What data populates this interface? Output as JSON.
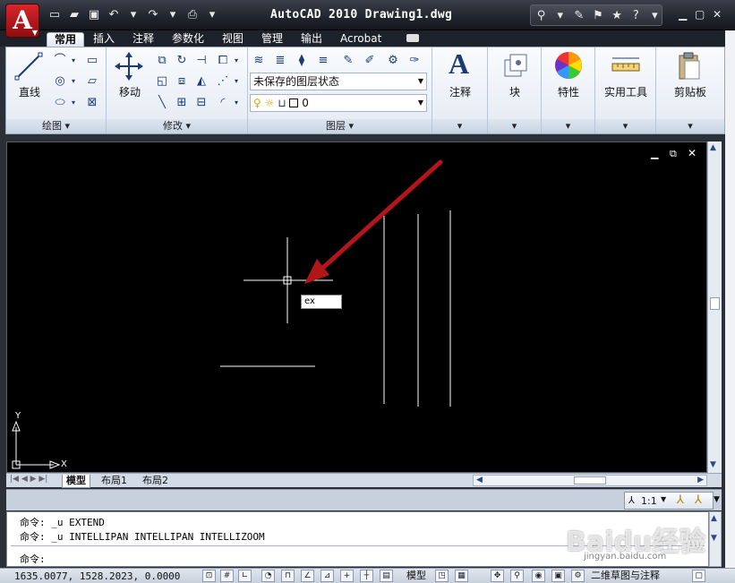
{
  "window": {
    "title": "AutoCAD 2010   Drawing1.dwg",
    "app_logo": "A",
    "brand_color": "#c8151b"
  },
  "ribbon_tabs": [
    {
      "label": "常用",
      "active": true
    },
    {
      "label": "插入"
    },
    {
      "label": "注释"
    },
    {
      "label": "参数化"
    },
    {
      "label": "视图"
    },
    {
      "label": "管理"
    },
    {
      "label": "输出"
    },
    {
      "label": "Acrobat"
    }
  ],
  "panels": {
    "draw": {
      "title": "绘图",
      "line_label": "直线"
    },
    "modify": {
      "title": "修改",
      "move_label": "移动"
    },
    "layers": {
      "title": "图层",
      "layer_state": "未保存的图层状态",
      "current_layer": "0"
    },
    "annotate": {
      "label": "注释"
    },
    "block": {
      "label": "块"
    },
    "properties": {
      "label": "特性"
    },
    "utilities": {
      "label": "实用工具"
    },
    "clipboard": {
      "label": "剪贴板"
    }
  },
  "drawing": {
    "dynamic_input": "ex",
    "ucs_x": "X",
    "ucs_y": "Y"
  },
  "layout_tabs": [
    "模型",
    "布局1",
    "布局2"
  ],
  "annotation_scale": "1:1",
  "command": {
    "history": [
      "命令: _u EXTEND",
      "命令: _u INTELLIPAN INTELLIPAN INTELLIZOOM"
    ],
    "prompt": "命令:"
  },
  "status": {
    "coordinates": "1635.0077,  1528.2023,  0.0000",
    "model_label": "模型",
    "workspace": "二维草图与注释"
  },
  "watermark": {
    "text": "Baidu经验",
    "url": "jingyan.baidu.com"
  }
}
